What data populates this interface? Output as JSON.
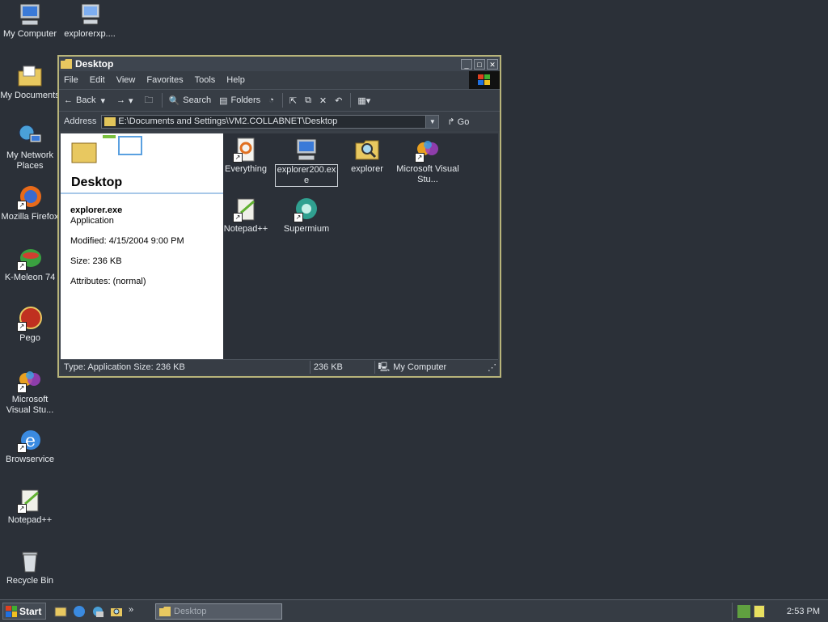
{
  "desktop_icons": [
    {
      "id": "my-computer",
      "label": "My Computer"
    },
    {
      "id": "explorerxp",
      "label": "explorerxp...."
    },
    {
      "id": "my-documents",
      "label": "My Documents"
    },
    {
      "id": "my-network-places",
      "label": "My Network Places"
    },
    {
      "id": "mozilla-firefox",
      "label": "Mozilla Firefox"
    },
    {
      "id": "k-meleon",
      "label": "K-Meleon 74"
    },
    {
      "id": "pego",
      "label": "Pego"
    },
    {
      "id": "ms-visual-studio",
      "label": "Microsoft Visual Stu..."
    },
    {
      "id": "browservice",
      "label": "Browservice"
    },
    {
      "id": "notepadpp",
      "label": "Notepad++"
    },
    {
      "id": "recycle-bin",
      "label": "Recycle Bin"
    }
  ],
  "window": {
    "title": "Desktop",
    "menu": [
      "File",
      "Edit",
      "View",
      "Favorites",
      "Tools",
      "Help"
    ],
    "toolbar": {
      "back": "Back",
      "search": "Search",
      "folders": "Folders"
    },
    "address": {
      "label": "Address",
      "value": "E:\\Documents and Settings\\VM2.COLLABNET\\Desktop",
      "go": "Go"
    },
    "left_pane": {
      "title": "Desktop",
      "file_name": "explorer.exe",
      "file_type": "Application",
      "modified": "Modified: 4/15/2004 9:00 PM",
      "size": "Size: 236 KB",
      "attributes": "Attributes: (normal)"
    },
    "files": [
      {
        "label": "Everything"
      },
      {
        "label": "explorer200.exe"
      },
      {
        "label": "explorer"
      },
      {
        "label": "Microsoft Visual Stu..."
      },
      {
        "label": "Notepad++"
      },
      {
        "label": "Supermium"
      }
    ],
    "status": {
      "type": "Type: Application Size: 236 KB",
      "size": "236 KB",
      "zone": "My Computer"
    }
  },
  "taskbar": {
    "start": "Start",
    "task_button": "Desktop",
    "clock": "2:53 PM"
  },
  "colors": {
    "accent": "#b8b47a",
    "window_bg": "#3a4048",
    "desktop_bg": "#2b3038"
  }
}
